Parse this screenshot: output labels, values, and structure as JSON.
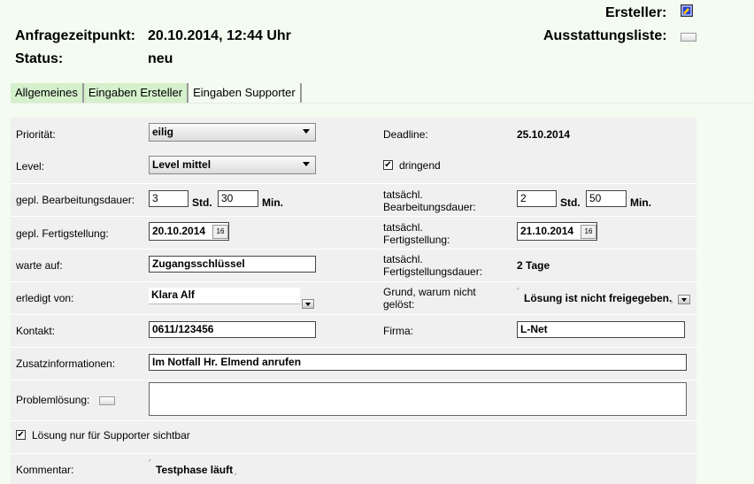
{
  "header": {
    "creator_label": "Ersteller:",
    "equipment_label": "Ausstattungsliste:",
    "request_time_label": "Anfragezeitpunkt:",
    "request_time_value": "20.10.2014, 12:44 Uhr",
    "status_label": "Status:",
    "status_value": "neu"
  },
  "tabs": [
    {
      "label": "Allgemeines"
    },
    {
      "label": "Eingaben Ersteller"
    },
    {
      "label": "Eingaben Supporter"
    }
  ],
  "form": {
    "priority_label": "Priorität:",
    "priority_value": "eilig",
    "deadline_label": "Deadline:",
    "deadline_value": "25.10.2014",
    "level_label": "Level:",
    "level_value": "Level mittel",
    "urgent_label": "dringend",
    "urgent_checked": true,
    "planned_duration_label": "gepl. Bearbeitungsdauer:",
    "planned_hours": "3",
    "planned_minutes": "30",
    "hours_unit": "Std.",
    "minutes_unit": "Min.",
    "actual_duration_label_1": "tatsächl.",
    "actual_duration_label_2": "Bearbeitungsdauer:",
    "actual_hours": "2",
    "actual_minutes": "50",
    "planned_completion_label": "gepl. Fertigstellung:",
    "planned_completion_value": "20.10.2014",
    "actual_completion_label_1": "tatsächl.",
    "actual_completion_label_2": "Fertigstellung:",
    "actual_completion_value": "21.10.2014",
    "calendar_icon_text": "16",
    "waiting_for_label": "warte auf:",
    "waiting_for_value": "Zugangsschlüssel",
    "actual_completion_duration_label_1": "tatsächl.",
    "actual_completion_duration_label_2": "Fertigstellungsdauer:",
    "actual_completion_duration_value": "2 Tage",
    "done_by_label": "erledigt von:",
    "done_by_value": "Klara Alf",
    "reason_label_1": "Grund, warum nicht",
    "reason_label_2": "gelöst:",
    "reason_value": "Lösung ist nicht freigegeben.",
    "contact_label": "Kontakt:",
    "contact_value": "0611/123456",
    "company_label": "Firma:",
    "company_value": "L-Net",
    "additional_info_label": "Zusatzinformationen:",
    "additional_info_value": "Im Notfall Hr. Elmend anrufen",
    "solution_label": "Problemlösung:",
    "solution_value": "",
    "solution_visible_label": "Lösung nur für Supporter sichtbar",
    "solution_visible_checked": true,
    "comment_label": "Kommentar:",
    "comment_value": "Testphase läuft"
  }
}
